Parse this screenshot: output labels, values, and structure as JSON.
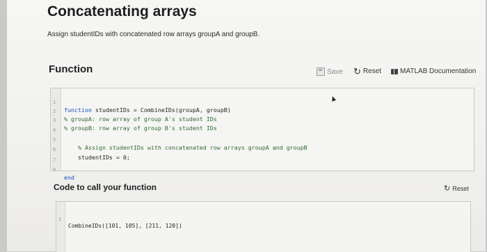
{
  "page": {
    "title": "Concatenating arrays",
    "description": "Assign studentIDs with concatenated row arrays groupA and groupB."
  },
  "function_section": {
    "title": "Function",
    "toolbar": {
      "save_label": "Save",
      "reset_label": "Reset",
      "doc_label": "MATLAB Documentation"
    },
    "lines": [
      {
        "num": "1",
        "kw": "function",
        "text": " studentIDs = CombineIDs(groupA, groupB)",
        "cm": ""
      },
      {
        "num": "2",
        "kw": "",
        "text": "",
        "cm": "% groupA: row array of group A's student IDs"
      },
      {
        "num": "3",
        "kw": "",
        "text": "",
        "cm": "% groupB: row array of group B's student IDs"
      },
      {
        "num": "4",
        "kw": "",
        "text": "",
        "cm": ""
      },
      {
        "num": "5",
        "kw": "",
        "text": "",
        "cm": "    % Assign studentIDs with concatenated row arrays groupA and groupB"
      },
      {
        "num": "6",
        "kw": "",
        "text": "    studentIDs = 0;",
        "cm": ""
      },
      {
        "num": "7",
        "kw": "",
        "text": "",
        "cm": ""
      },
      {
        "num": "8",
        "kw": "end",
        "text": "",
        "cm": ""
      }
    ]
  },
  "call_section": {
    "title": "Code to call your function",
    "reset_label": "Reset",
    "lines": [
      {
        "num": "1",
        "text": "CombineIDs([101, 105], [211, 120])"
      }
    ]
  },
  "icons": {
    "save": "save-disk-icon",
    "reset": "reset-arrow-icon",
    "doc": "book-icon",
    "cursor": "mouse-cursor-icon"
  }
}
